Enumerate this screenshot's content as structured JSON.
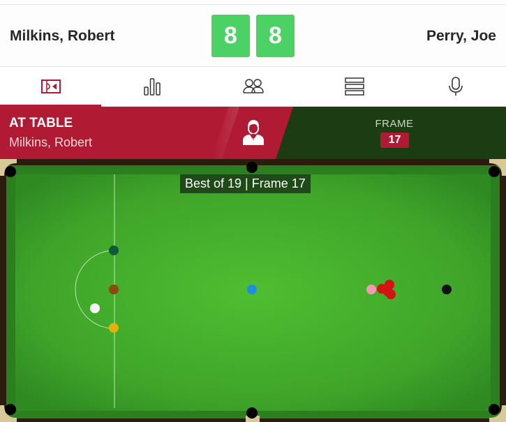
{
  "header": {
    "player_left": "Milkins, Robert",
    "player_right": "Perry, Joe",
    "score_left": "8",
    "score_right": "8"
  },
  "tabs": [
    {
      "icon": "table-icon",
      "active": true
    },
    {
      "icon": "stats-icon",
      "active": false
    },
    {
      "icon": "head-to-head-icon",
      "active": false
    },
    {
      "icon": "frame-list-icon",
      "active": false
    },
    {
      "icon": "commentary-icon",
      "active": false
    }
  ],
  "status": {
    "at_table_label": "AT TABLE",
    "at_table_player": "Milkins, Robert",
    "frame_label": "FRAME",
    "frame_number": "17"
  },
  "table": {
    "caption": "Best of 19 | Frame 17",
    "balls": [
      "green",
      "brown",
      "yellow",
      "white",
      "blue",
      "pink",
      "red",
      "red",
      "red",
      "red",
      "black"
    ]
  },
  "colors": {
    "accent_red": "#b01a33",
    "score_green": "#4cd164",
    "banner_dark_green": "#1c3d14",
    "cloth": "#45b02c"
  }
}
